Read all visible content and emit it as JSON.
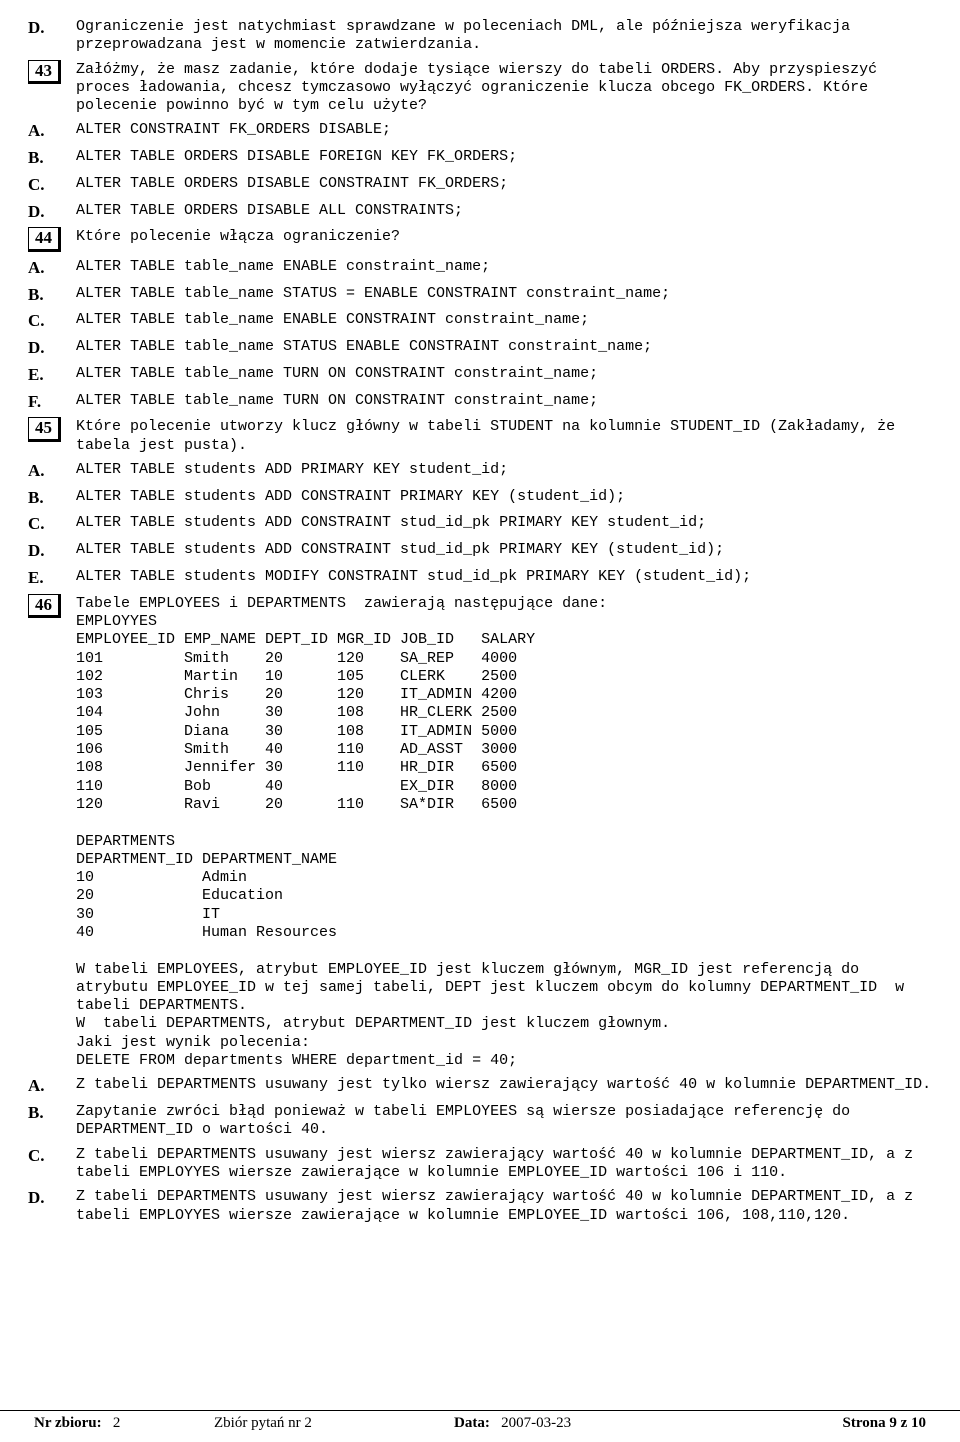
{
  "items": [
    {
      "lbl": "D.",
      "text": "Ograniczenie jest natychmiast sprawdzane w poleceniach DML, ale późniejsza weryfikacja przeprowadzana jest w momencie zatwierdzania."
    },
    {
      "lbl": "43",
      "q": true,
      "text": "Załóżmy, że masz zadanie, które dodaje tysiące wierszy do tabeli ORDERS. Aby przyspieszyć proces ładowania, chcesz tymczasowo wyłączyć ograniczenie klucza obcego FK_ORDERS. Które polecenie powinno być w tym celu użyte?"
    },
    {
      "lbl": "A.",
      "text": "ALTER CONSTRAINT FK_ORDERS DISABLE;"
    },
    {
      "lbl": "B.",
      "text": "ALTER TABLE ORDERS DISABLE FOREIGN KEY FK_ORDERS;"
    },
    {
      "lbl": "C.",
      "text": "ALTER TABLE ORDERS DISABLE CONSTRAINT FK_ORDERS;"
    },
    {
      "lbl": "D.",
      "text": "ALTER TABLE ORDERS DISABLE ALL CONSTRAINTS;"
    },
    {
      "lbl": "44",
      "q": true,
      "text": "Które polecenie włącza ograniczenie?"
    },
    {
      "lbl": "A.",
      "text": "ALTER TABLE table_name ENABLE constraint_name;"
    },
    {
      "lbl": "B.",
      "text": "ALTER TABLE table_name STATUS = ENABLE CONSTRAINT constraint_name;"
    },
    {
      "lbl": "C.",
      "text": "ALTER TABLE table_name ENABLE CONSTRAINT constraint_name;"
    },
    {
      "lbl": "D.",
      "text": "ALTER TABLE table_name STATUS ENABLE CONSTRAINT constraint_name;"
    },
    {
      "lbl": "E.",
      "text": "ALTER TABLE table_name TURN ON CONSTRAINT constraint_name;"
    },
    {
      "lbl": "F.",
      "text": "ALTER TABLE table_name TURN ON CONSTRAINT constraint_name;"
    },
    {
      "lbl": "45",
      "q": true,
      "text": "Które polecenie utworzy klucz główny w tabeli STUDENT na kolumnie STUDENT_ID (Zakładamy, że tabela jest pusta)."
    },
    {
      "lbl": "A.",
      "text": "ALTER TABLE students ADD PRIMARY KEY student_id;"
    },
    {
      "lbl": "B.",
      "text": "ALTER TABLE students ADD CONSTRAINT PRIMARY KEY (student_id);"
    },
    {
      "lbl": "C.",
      "text": "ALTER TABLE students ADD CONSTRAINT stud_id_pk PRIMARY KEY student_id;"
    },
    {
      "lbl": "D.",
      "text": "ALTER TABLE students ADD CONSTRAINT stud_id_pk PRIMARY KEY (student_id);"
    },
    {
      "lbl": "E.",
      "text": "ALTER TABLE students MODIFY CONSTRAINT stud_id_pk PRIMARY KEY (student_id);"
    },
    {
      "lbl": "46",
      "q": true,
      "text": "Tabele EMPLOYEES i DEPARTMENTS  zawierają następujące dane:\nEMPLOYYES\nEMPLOYEE_ID EMP_NAME DEPT_ID MGR_ID JOB_ID   SALARY\n101         Smith    20      120    SA_REP   4000\n102         Martin   10      105    CLERK    2500\n103         Chris    20      120    IT_ADMIN 4200\n104         John     30      108    HR_CLERK 2500\n105         Diana    30      108    IT_ADMIN 5000\n106         Smith    40      110    AD_ASST  3000\n108         Jennifer 30      110    HR_DIR   6500\n110         Bob      40             EX_DIR   8000\n120         Ravi     20      110    SA*DIR   6500\n\nDEPARTMENTS\nDEPARTMENT_ID DEPARTMENT_NAME\n10            Admin\n20            Education\n30            IT\n40            Human Resources\n\nW tabeli EMPLOYEES, atrybut EMPLOYEE_ID jest kluczem głównym, MGR_ID jest referencją do atrybutu EMPLOYEE_ID w tej samej tabeli, DEPT jest kluczem obcym do kolumny DEPARTMENT_ID  w tabeli DEPARTMENTS.\nW  tabeli DEPARTMENTS, atrybut DEPARTMENT_ID jest kluczem głownym.\nJaki jest wynik polecenia:\nDELETE FROM departments WHERE department_id = 40;"
    },
    {
      "lbl": "A.",
      "text": "Z tabeli DEPARTMENTS usuwany jest tylko wiersz zawierający wartość 40 w kolumnie DEPARTMENT_ID."
    },
    {
      "lbl": "B.",
      "text": "Zapytanie zwróci błąd ponieważ w tabeli EMPLOYEES są wiersze posiadające referencję do DEPARTMENT_ID o wartości 40."
    },
    {
      "lbl": "C.",
      "text": "Z tabeli DEPARTMENTS usuwany jest wiersz zawierający wartość 40 w kolumnie DEPARTMENT_ID, a z tabeli EMPLOYYES wiersze zawierające w kolumnie EMPLOYEE_ID wartości 106 i 110."
    },
    {
      "lbl": "D.",
      "text": "Z tabeli DEPARTMENTS usuwany jest wiersz zawierający wartość 40 w kolumnie DEPARTMENT_ID, a z tabeli EMPLOYYES wiersze zawierające w kolumnie EMPLOYEE_ID wartości 106, 108,110,120."
    }
  ],
  "footer": {
    "nr_zbioru_label": "Nr zbioru:",
    "nr_zbioru": "2",
    "zbior_label": "Zbiór pytań nr 2",
    "data_label": "Data:",
    "data": "2007-03-23",
    "page": "Strona 9 z 10"
  }
}
